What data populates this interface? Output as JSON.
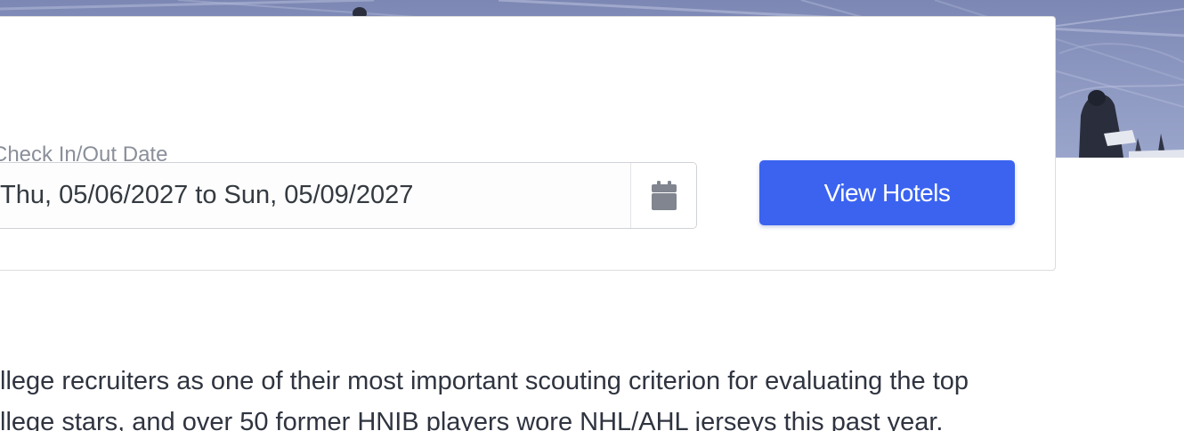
{
  "hero": {
    "image_name": "hockey-game-photo"
  },
  "booking": {
    "date_label": "Check In/Out Date",
    "date_value": "Thu, 05/06/2027 to Sun, 05/09/2027",
    "calendar_icon": "calendar-icon",
    "view_hotels_label": "View Hotels"
  },
  "content": {
    "line1": "llege recruiters as one of their most important scouting criterion for evaluating the top",
    "line2": "llege stars, and over 50 former HNIB players wore NHL/AHL jerseys this past year."
  },
  "colors": {
    "primary_button": "#3b63f0",
    "label_text": "#8a8f99",
    "body_text": "#2f3440"
  }
}
